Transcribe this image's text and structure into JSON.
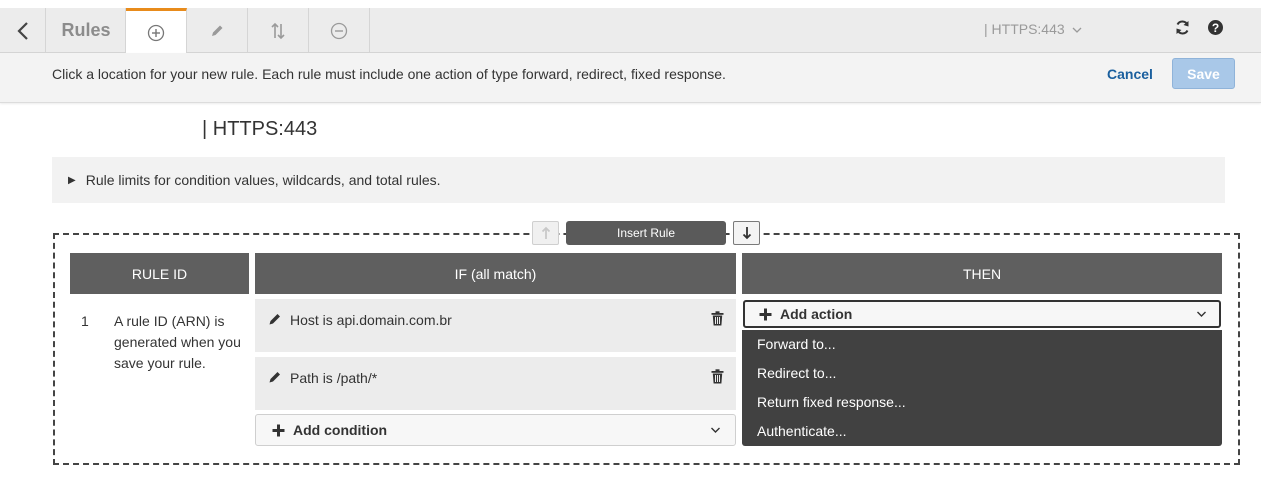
{
  "header": {
    "title": "Rules",
    "listener_select": "| HTTPS:443"
  },
  "infobar": {
    "text": "Click a location for your new rule. Each rule must include one action of type forward, redirect, fixed response.",
    "cancel_label": "Cancel",
    "save_label": "Save"
  },
  "listener_heading": "| HTTPS:443",
  "limits": {
    "label": "Rule limits for condition values, wildcards, and total rules."
  },
  "insert_rule_label": "Insert Rule",
  "columns": {
    "rule_id": "RULE ID",
    "if": "IF (all match)",
    "then": "THEN"
  },
  "rule": {
    "number": "1",
    "note": "A rule ID (ARN) is generated when you save your rule.",
    "conditions": [
      {
        "text": "Host is api.domain.com.br"
      },
      {
        "text": "Path is /path/*"
      }
    ],
    "add_condition_label": "Add condition",
    "add_action_label": "Add action",
    "action_menu": [
      {
        "label": "Forward to..."
      },
      {
        "label": "Redirect to..."
      },
      {
        "label": "Return fixed response..."
      },
      {
        "label": "Authenticate..."
      }
    ]
  },
  "colors": {
    "active_tab_accent": "#e88b1b",
    "link": "#1a5f9e",
    "save_disabled": "#a9c8e8",
    "header_bg": "#5f5f5f",
    "menu_bg": "#414141"
  },
  "icons": [
    "chevron-left-icon",
    "plus-circle-icon",
    "pencil-icon",
    "sort-icon",
    "minus-circle-icon",
    "refresh-icon",
    "help-icon",
    "trash-icon",
    "plus-icon",
    "chevron-down-icon",
    "arrow-up-icon",
    "arrow-down-icon",
    "caret-right-icon"
  ]
}
